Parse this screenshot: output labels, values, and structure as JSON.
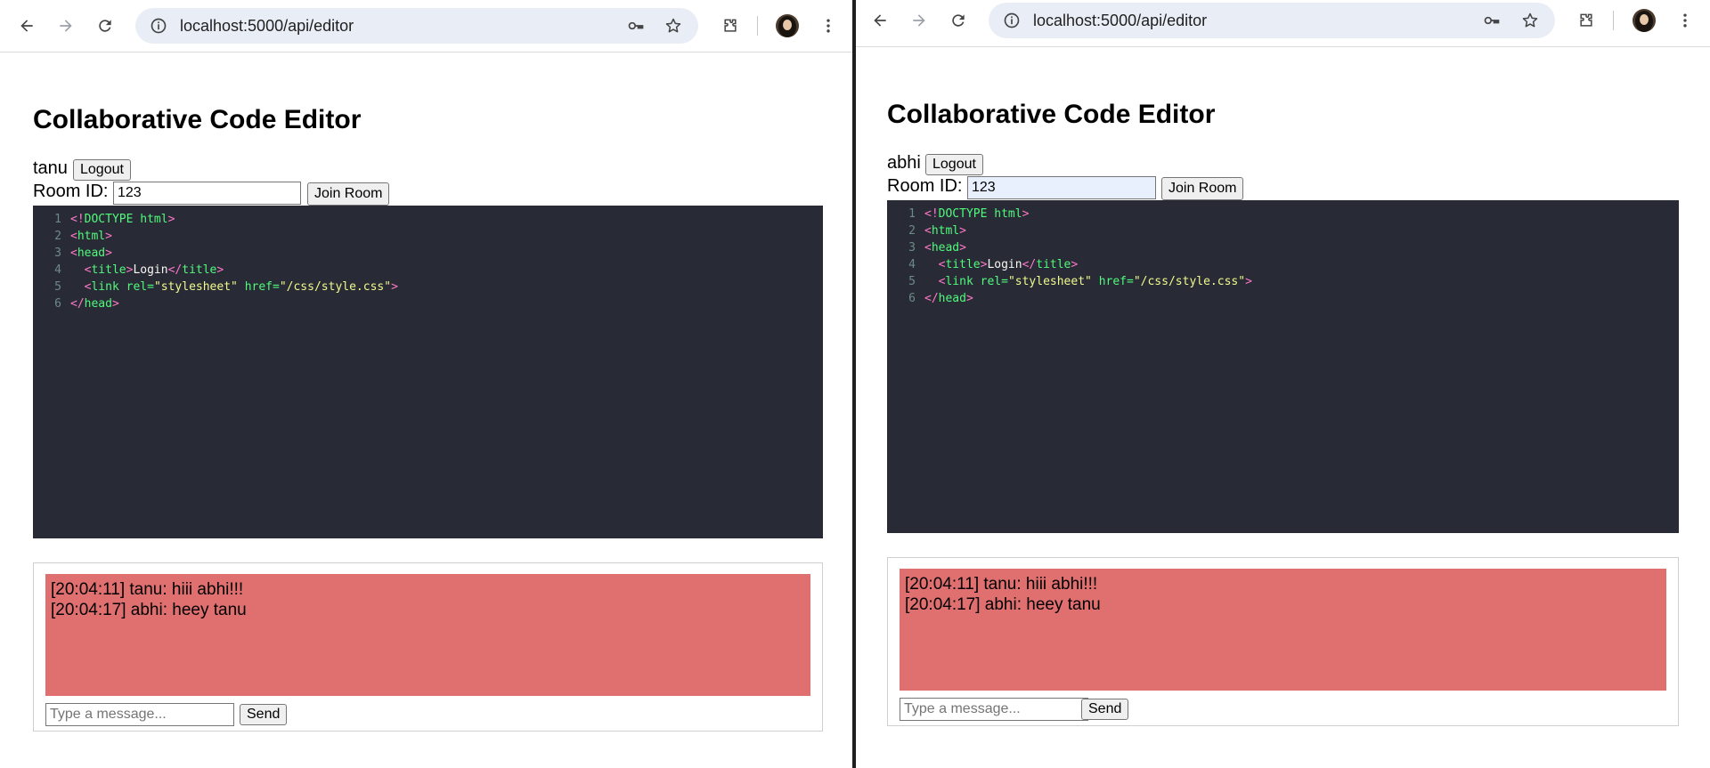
{
  "browser": {
    "url": "localhost:5000/api/editor"
  },
  "app": {
    "title": "Collaborative Code Editor",
    "logout_label": "Logout",
    "room_label": "Room ID:",
    "join_label": "Join Room",
    "send_label": "Send",
    "message_placeholder": "Type a message...",
    "code_lines": [
      {
        "num": "1",
        "tokens": [
          {
            "c": "t-punct",
            "t": "<!"
          },
          {
            "c": "t-tag",
            "t": "DOCTYPE html"
          },
          {
            "c": "t-punct",
            "t": ">"
          }
        ]
      },
      {
        "num": "2",
        "tokens": [
          {
            "c": "t-punct",
            "t": "<"
          },
          {
            "c": "t-tag",
            "t": "html"
          },
          {
            "c": "t-punct",
            "t": ">"
          }
        ]
      },
      {
        "num": "3",
        "tokens": [
          {
            "c": "t-punct",
            "t": "<"
          },
          {
            "c": "t-tag",
            "t": "head"
          },
          {
            "c": "t-punct",
            "t": ">"
          }
        ]
      },
      {
        "num": "4",
        "tokens": [
          {
            "c": "t-text",
            "t": "  "
          },
          {
            "c": "t-punct",
            "t": "<"
          },
          {
            "c": "t-tag",
            "t": "title"
          },
          {
            "c": "t-punct",
            "t": ">"
          },
          {
            "c": "t-text",
            "t": "Login"
          },
          {
            "c": "t-punct",
            "t": "</"
          },
          {
            "c": "t-tag",
            "t": "title"
          },
          {
            "c": "t-punct",
            "t": ">"
          }
        ]
      },
      {
        "num": "5",
        "tokens": [
          {
            "c": "t-text",
            "t": "  "
          },
          {
            "c": "t-punct",
            "t": "<"
          },
          {
            "c": "t-tag",
            "t": "link"
          },
          {
            "c": "t-text",
            "t": " "
          },
          {
            "c": "t-attr",
            "t": "rel="
          },
          {
            "c": "t-str",
            "t": "\"stylesheet\""
          },
          {
            "c": "t-text",
            "t": " "
          },
          {
            "c": "t-attr",
            "t": "href="
          },
          {
            "c": "t-str",
            "t": "\"/css/style.css\""
          },
          {
            "c": "t-punct",
            "t": ">"
          }
        ]
      },
      {
        "num": "6",
        "tokens": [
          {
            "c": "t-punct",
            "t": "</"
          },
          {
            "c": "t-tag",
            "t": "head"
          },
          {
            "c": "t-punct",
            "t": ">"
          }
        ]
      }
    ],
    "messages": [
      "[20:04:11] tanu: hiii abhi!!!",
      "[20:04:17] abhi: heey tanu"
    ]
  },
  "left": {
    "username": "tanu",
    "room_value": "123"
  },
  "right": {
    "username": "abhi",
    "room_value": "123"
  },
  "colors": {
    "editor_bg": "#282a36",
    "chat_bg": "#e06f6f",
    "omnibox_bg": "#e9eef6"
  }
}
